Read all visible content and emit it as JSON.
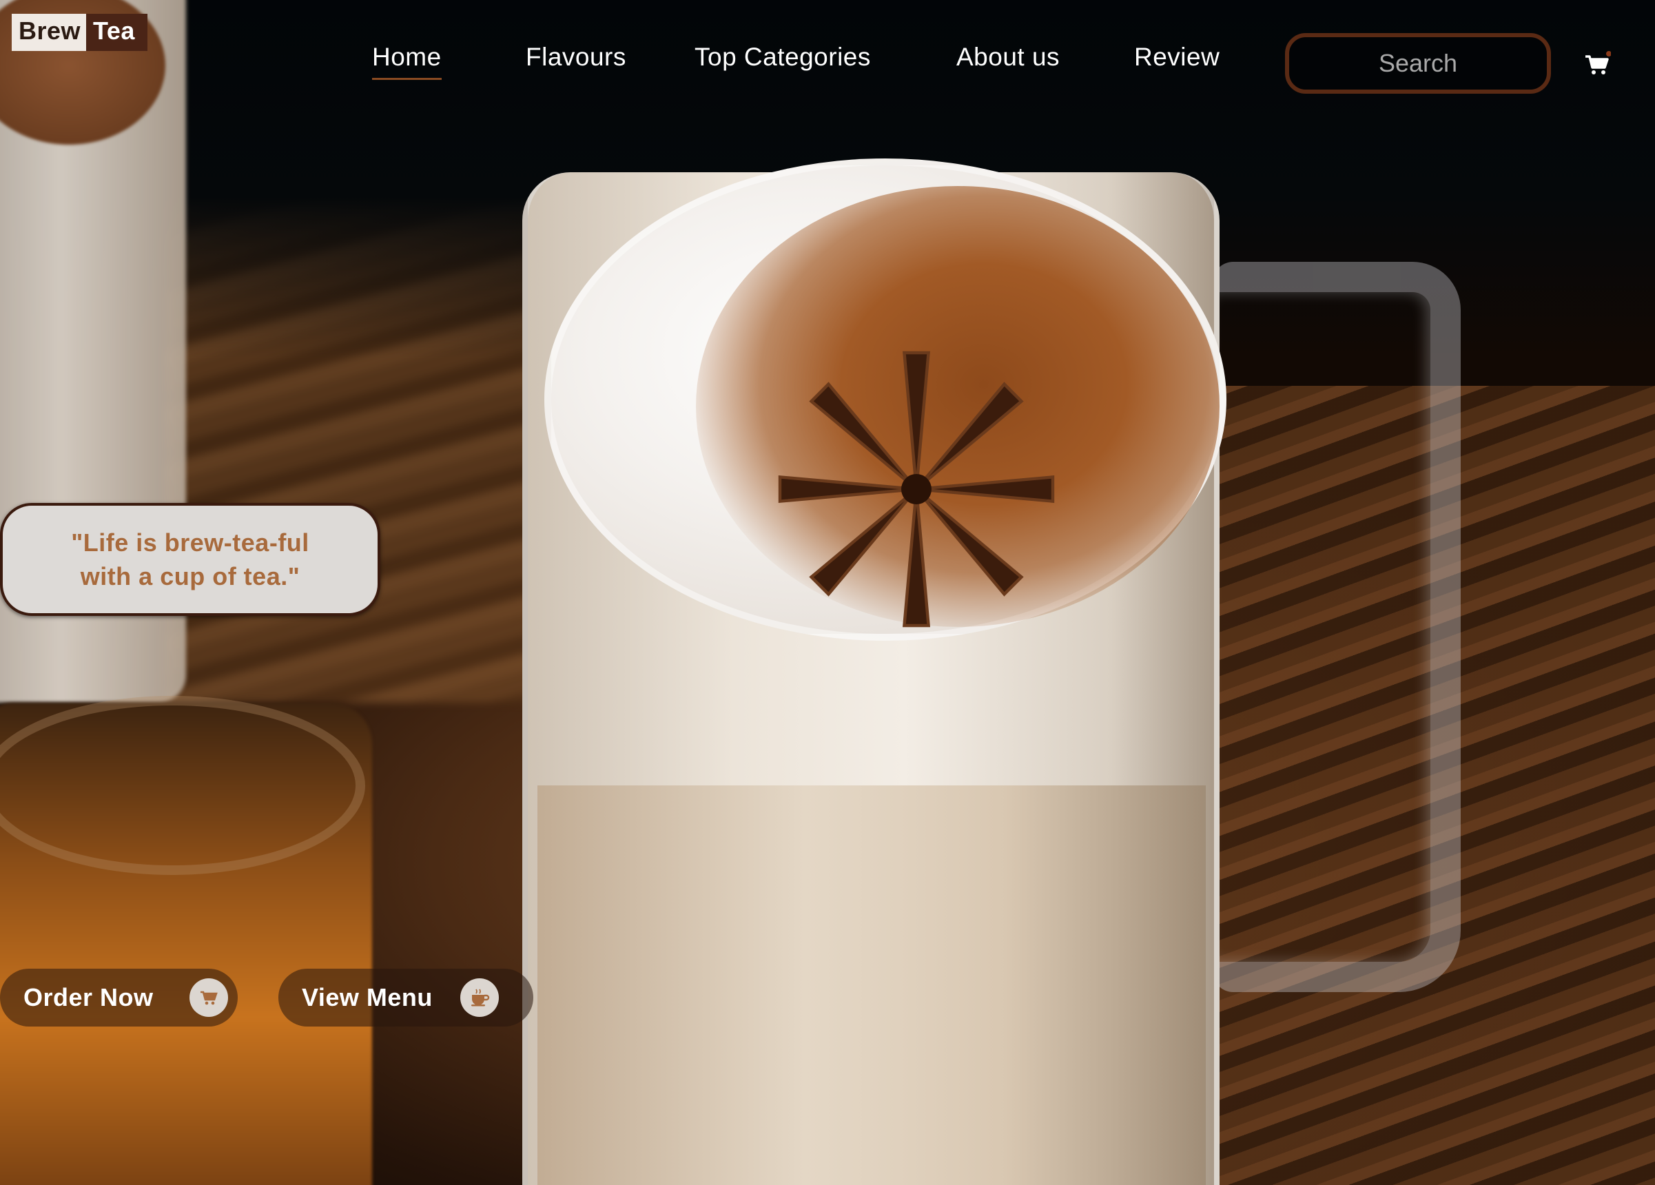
{
  "brand": {
    "word1": "Brew",
    "word2": "Tea"
  },
  "nav": {
    "items": [
      {
        "label": "Home",
        "active": true
      },
      {
        "label": "Flavours",
        "active": false
      },
      {
        "label": "Top Categories",
        "active": false
      },
      {
        "label": "About us",
        "active": false
      },
      {
        "label": "Review",
        "active": false
      }
    ]
  },
  "search": {
    "placeholder": "Search"
  },
  "quote": {
    "text": "\"Life is brew-tea-ful\nwith a cup of tea.\""
  },
  "cta": {
    "order_label": "Order Now",
    "menu_label": "View Menu"
  },
  "icons": {
    "cart": "cart-icon",
    "order": "cart-icon",
    "menu": "teacup-icon"
  },
  "colors": {
    "accent": "#a86a3c",
    "brand_dark": "#4a2416",
    "search_border": "#5a2a14"
  }
}
